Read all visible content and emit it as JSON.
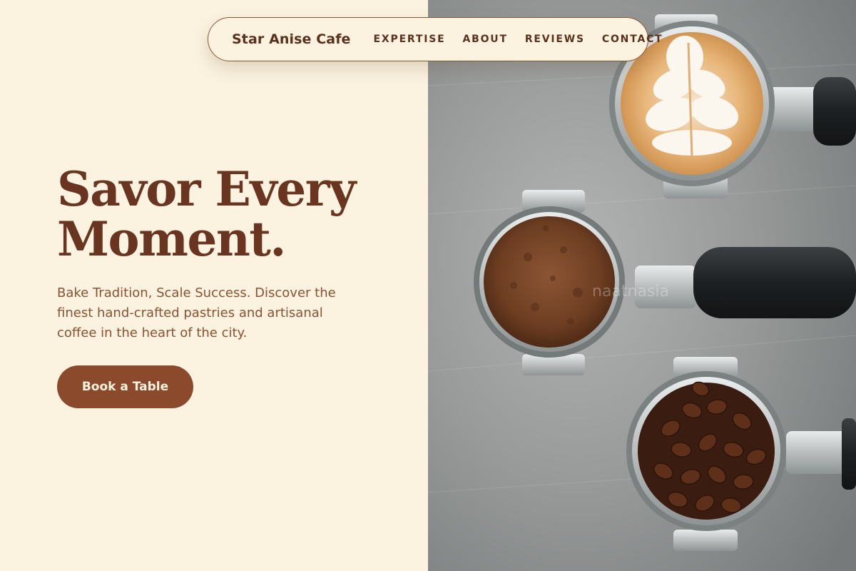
{
  "header": {
    "brand": "Star Anise Cafe",
    "nav": [
      "EXPERTISE",
      "ABOUT",
      "REVIEWS",
      "CONTACT"
    ]
  },
  "hero": {
    "title_line1": "Savor Every",
    "title_line2": "Moment.",
    "description": "Bake Tradition, Scale Success. Discover the finest hand-crafted pastries and artisanal coffee in the heart of the city.",
    "cta_label": "Book a Table"
  },
  "image": {
    "icon": "coffee-portafilters-photo",
    "subject": [
      "latte art",
      "ground coffee",
      "coffee beans"
    ],
    "watermark": "naatnasia"
  },
  "colors": {
    "background": "#fbf3e0",
    "brand_text": "#5b311d",
    "title": "#6a3520",
    "body_text": "#8a5233",
    "button": "#8b4a2b",
    "button_text": "#fbf3e0"
  }
}
